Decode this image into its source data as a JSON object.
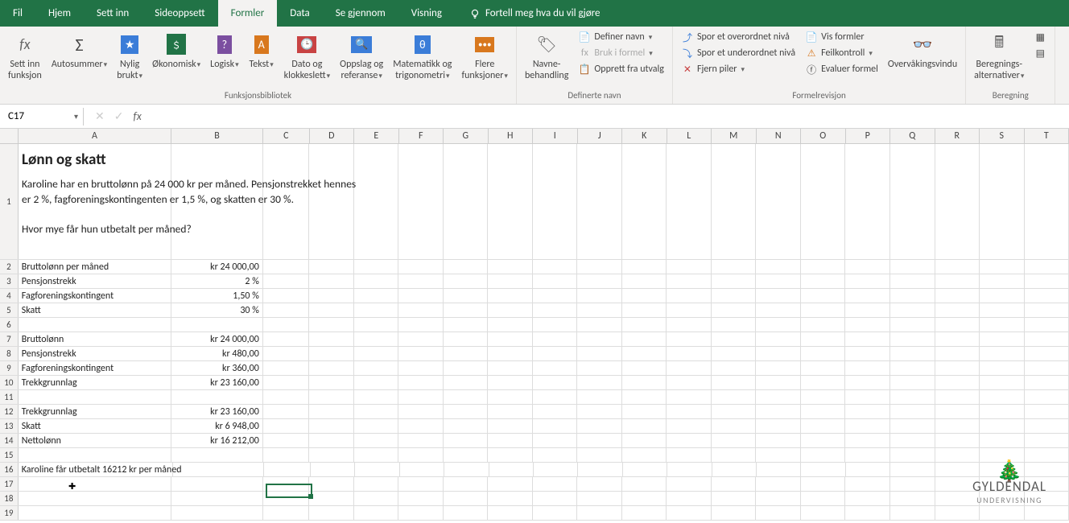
{
  "tabs": {
    "fil": "Fil",
    "hjem": "Hjem",
    "settinn": "Sett inn",
    "sideoppsett": "Sideoppsett",
    "formler": "Formler",
    "data": "Data",
    "segjennom": "Se gjennom",
    "visning": "Visning",
    "tellme": "Fortell meg hva du vil gjøre"
  },
  "ribbon": {
    "groups": {
      "funksjonsbibliotek": "Funksjonsbibliotek",
      "definerte_navn": "Definerte navn",
      "formelrevisjon": "Formelrevisjon",
      "beregning": "Beregning"
    },
    "insert_function": "Sett inn\nfunksjon",
    "autosum": "Autosummer",
    "recently_used": "Nylig\nbrukt",
    "financial": "Økonomisk",
    "logical": "Logisk",
    "text": "Tekst",
    "datetime": "Dato og\nklokkeslett",
    "lookup": "Oppslag og\nreferanse",
    "math": "Matematikk og\ntrigonometri",
    "more": "Flere\nfunksjoner",
    "name_manager": "Navne-\nbehandling",
    "define_name": "Definer navn",
    "use_in_formula": "Bruk i formel",
    "create_from_selection": "Opprett fra utvalg",
    "trace_precedents": "Spor et overordnet nivå",
    "trace_dependents": "Spor et underordnet nivå",
    "remove_arrows": "Fjern piler",
    "show_formulas": "Vis formler",
    "error_checking": "Feilkontroll",
    "evaluate_formula": "Evaluer formel",
    "watch_window": "Overvåkingsvindu",
    "calc_options": "Beregnings-\nalternativer"
  },
  "namebox": "C17",
  "formula": "",
  "columns": [
    "A",
    "B",
    "C",
    "D",
    "E",
    "F",
    "G",
    "H",
    "I",
    "J",
    "K",
    "L",
    "M",
    "N",
    "O",
    "P",
    "Q",
    "R",
    "S",
    "T"
  ],
  "rownums": [
    "1",
    "2",
    "3",
    "4",
    "5",
    "6",
    "7",
    "8",
    "9",
    "10",
    "11",
    "12",
    "13",
    "14",
    "15",
    "16",
    "17",
    "18",
    "19"
  ],
  "doc": {
    "title": "Lønn og skatt",
    "para1": "Karoline har en bruttolønn på 24 000 kr per måned. Pensjonstrekket hennes",
    "para2": "er 2 %, fagforeningskontingenten er 1,5 %, og skatten er 30 %.",
    "para3": "Hvor mye får hun utbetalt per måned?"
  },
  "cells": {
    "a2": "Bruttolønn per måned",
    "b2": "kr 24 000,00",
    "a3": "Pensjonstrekk",
    "b3": "2 %",
    "a4": "Fagforeningskontingent",
    "b4": "1,50 %",
    "a5": "Skatt",
    "b5": "30 %",
    "a7": "Bruttolønn",
    "b7": "kr 24 000,00",
    "a8": "Pensjonstrekk",
    "b8": "kr 480,00",
    "a9": "Fagforeningskontingent",
    "b9": "kr 360,00",
    "a10": "Trekkgrunnlag",
    "b10": "kr 23 160,00",
    "a12": "Trekkgrunnlag",
    "b12": "kr 23 160,00",
    "a13": "Skatt",
    "b13": "kr 6 948,00",
    "a14": "Nettolønn",
    "b14": "kr 16 212,00",
    "a16": "Karoline får utbetalt 16212 kr per måned"
  },
  "logo": {
    "name": "GYLDENDAL",
    "sub": "UNDERVISNING"
  }
}
